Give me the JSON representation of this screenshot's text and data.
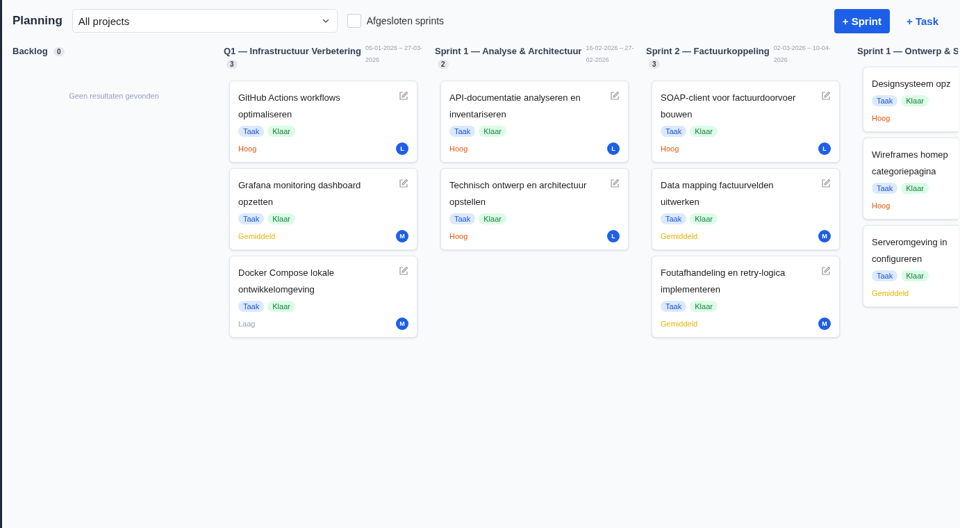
{
  "header": {
    "title": "Planning",
    "project_select": {
      "value": "All projects"
    },
    "closed_sprints": {
      "label": "Afgesloten sprints",
      "checked": false
    },
    "buttons": [
      {
        "label": "+ Sprint",
        "kind": "primary"
      },
      {
        "label": "+ Task",
        "kind": "link"
      }
    ]
  },
  "columns": [
    {
      "title": "Backlog",
      "count": "0",
      "empty_text": "Geen resultaten gevonden"
    },
    {
      "title": "Q1 — Infrastructuur Verbetering",
      "dates": "05-01-2026 – 27-03-2026",
      "count": "3",
      "cards": [
        {
          "title_lines": [
            "GitHub Actions workflows",
            "optimaliseren"
          ],
          "tags": [
            "Taak",
            "Klaar"
          ],
          "priority": "Hoog",
          "color": "#ea580c",
          "assignee": "L"
        },
        {
          "title_lines": [
            "Grafana monitoring dashboard",
            "opzetten"
          ],
          "tags": [
            "Taak",
            "Klaar"
          ],
          "priority": "Gemiddeld",
          "color": "#eab308",
          "assignee": "M"
        },
        {
          "title_lines": [
            "Docker Compose lokale",
            "ontwikkelomgeving"
          ],
          "tags": [
            "Taak",
            "Klaar"
          ],
          "priority": "Laag",
          "color": "#94a3b8",
          "assignee": "M"
        }
      ]
    },
    {
      "title": "Sprint 1 — Analyse & Architectuur",
      "dates": "16-02-2026 – 27-02-2026",
      "count": "2",
      "cards": [
        {
          "title_lines": [
            "API-documentatie analyseren en",
            "inventariseren"
          ],
          "tags": [
            "Taak",
            "Klaar"
          ],
          "priority": "Hoog",
          "color": "#ea580c",
          "assignee": "L"
        },
        {
          "title_lines": [
            "Technisch ontwerp en architectuur",
            "opstellen"
          ],
          "tags": [
            "Taak",
            "Klaar"
          ],
          "priority": "Hoog",
          "color": "#ea580c",
          "assignee": "L"
        }
      ]
    },
    {
      "title": "Sprint 2 — Factuurkoppeling",
      "dates": "02-03-2026 – 10-04-2026",
      "count": "3",
      "cards": [
        {
          "title_lines": [
            "SOAP-client voor factuurdoorvoer",
            "bouwen"
          ],
          "tags": [
            "Taak",
            "Klaar"
          ],
          "priority": "Hoog",
          "color": "#ea580c",
          "assignee": "L"
        },
        {
          "title_lines": [
            "Data mapping factuurvelden",
            "uitwerken"
          ],
          "tags": [
            "Taak",
            "Klaar"
          ],
          "priority": "Gemiddeld",
          "color": "#eab308",
          "assignee": "M"
        },
        {
          "title_lines": [
            "Foutafhandeling en retry-logica",
            "implementeren"
          ],
          "tags": [
            "Taak",
            "Klaar"
          ],
          "priority": "Gemiddeld",
          "color": "#eab308",
          "assignee": "M"
        }
      ]
    },
    {
      "title": "Sprint 1 — Ontwerp & S",
      "cards": [
        {
          "title_lines": [
            "Designsysteem opz"
          ],
          "tags": [
            "Taak",
            "Klaar"
          ],
          "priority": "Hoog",
          "color": "#ea580c"
        },
        {
          "title_lines": [
            "Wireframes homep",
            "categoriepagina"
          ],
          "tags": [
            "Taak",
            "Klaar"
          ],
          "priority": "Hoog",
          "color": "#ea580c"
        },
        {
          "title_lines": [
            "Serveromgeving in",
            "configureren"
          ],
          "tags": [
            "Taak",
            "Klaar"
          ],
          "priority": "Gemiddeld",
          "color": "#eab308"
        }
      ]
    }
  ]
}
